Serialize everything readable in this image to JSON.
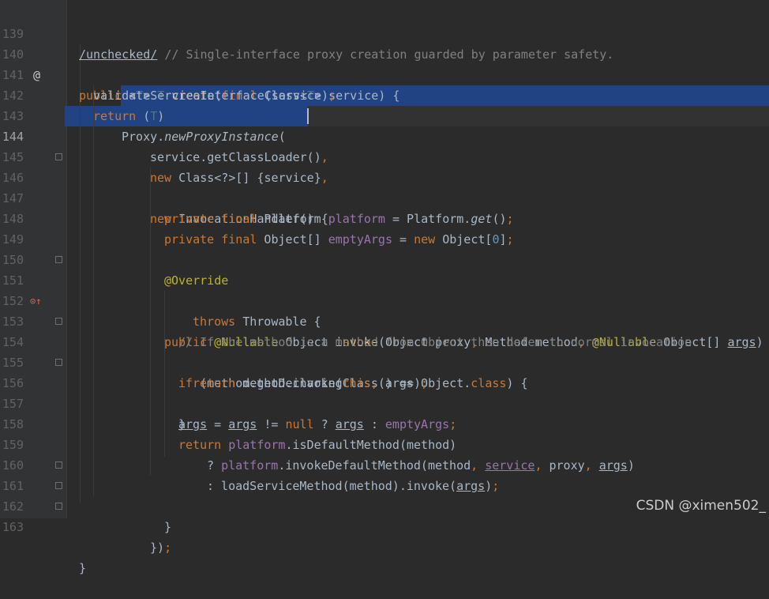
{
  "editor": {
    "lines": [
      {
        "n": "139",
        "t": "/unchecked/ // Single-interface proxy creation guarded by parameter safety."
      },
      {
        "n": "140",
        "t": "public <T> T create(final Class<T> service) {"
      },
      {
        "n": "141",
        "t": "validateServiceInterface(service);"
      },
      {
        "n": "142",
        "t": "return (T)"
      },
      {
        "n": "143",
        "t": "Proxy.newProxyInstance("
      },
      {
        "n": "144",
        "t": "service.getClassLoader(),"
      },
      {
        "n": "145",
        "t": "new Class<?>[] {service},"
      },
      {
        "n": "146",
        "t": "new InvocationHandler() {"
      },
      {
        "n": "147",
        "t": "private final Platform platform = Platform.get();"
      },
      {
        "n": "148",
        "t": "private final Object[] emptyArgs = new Object[0];"
      },
      {
        "n": "149",
        "t": ""
      },
      {
        "n": "150",
        "t": "@Override"
      },
      {
        "n": "151",
        "t": "public @Nullable Object invoke(Object proxy, Method method, @Nullable Object[] args)"
      },
      {
        "n": "152",
        "t": "throws Throwable {"
      },
      {
        "n": "153",
        "t": "// If the method is a method from Object then defer to normal invocation."
      },
      {
        "n": "154",
        "t": "if (method.getDeclaringClass() == Object.class) {"
      },
      {
        "n": "155",
        "t": "return method.invoke(this, args);"
      },
      {
        "n": "156",
        "t": "}"
      },
      {
        "n": "157",
        "t": "args = args != null ? args : emptyArgs;"
      },
      {
        "n": "158",
        "t": "return platform.isDefaultMethod(method)"
      },
      {
        "n": "159",
        "t": "? platform.invokeDefaultMethod(method, service, proxy, args)"
      },
      {
        "n": "160",
        "t": ": loadServiceMethod(method).invoke(args);"
      },
      {
        "n": "161",
        "t": "}"
      },
      {
        "n": "162",
        "t": "});"
      },
      {
        "n": "163",
        "t": "}"
      }
    ]
  },
  "gutter": {
    "marker_140": "@",
    "marker_151": "⊙↑"
  },
  "watermark": "CSDN @ximen502_",
  "colors": {
    "background": "#2B2B2B",
    "selection": "#214283",
    "keyword": "#CC7832",
    "function": "#FFC66D",
    "comment": "#808080",
    "field": "#9876AA"
  }
}
